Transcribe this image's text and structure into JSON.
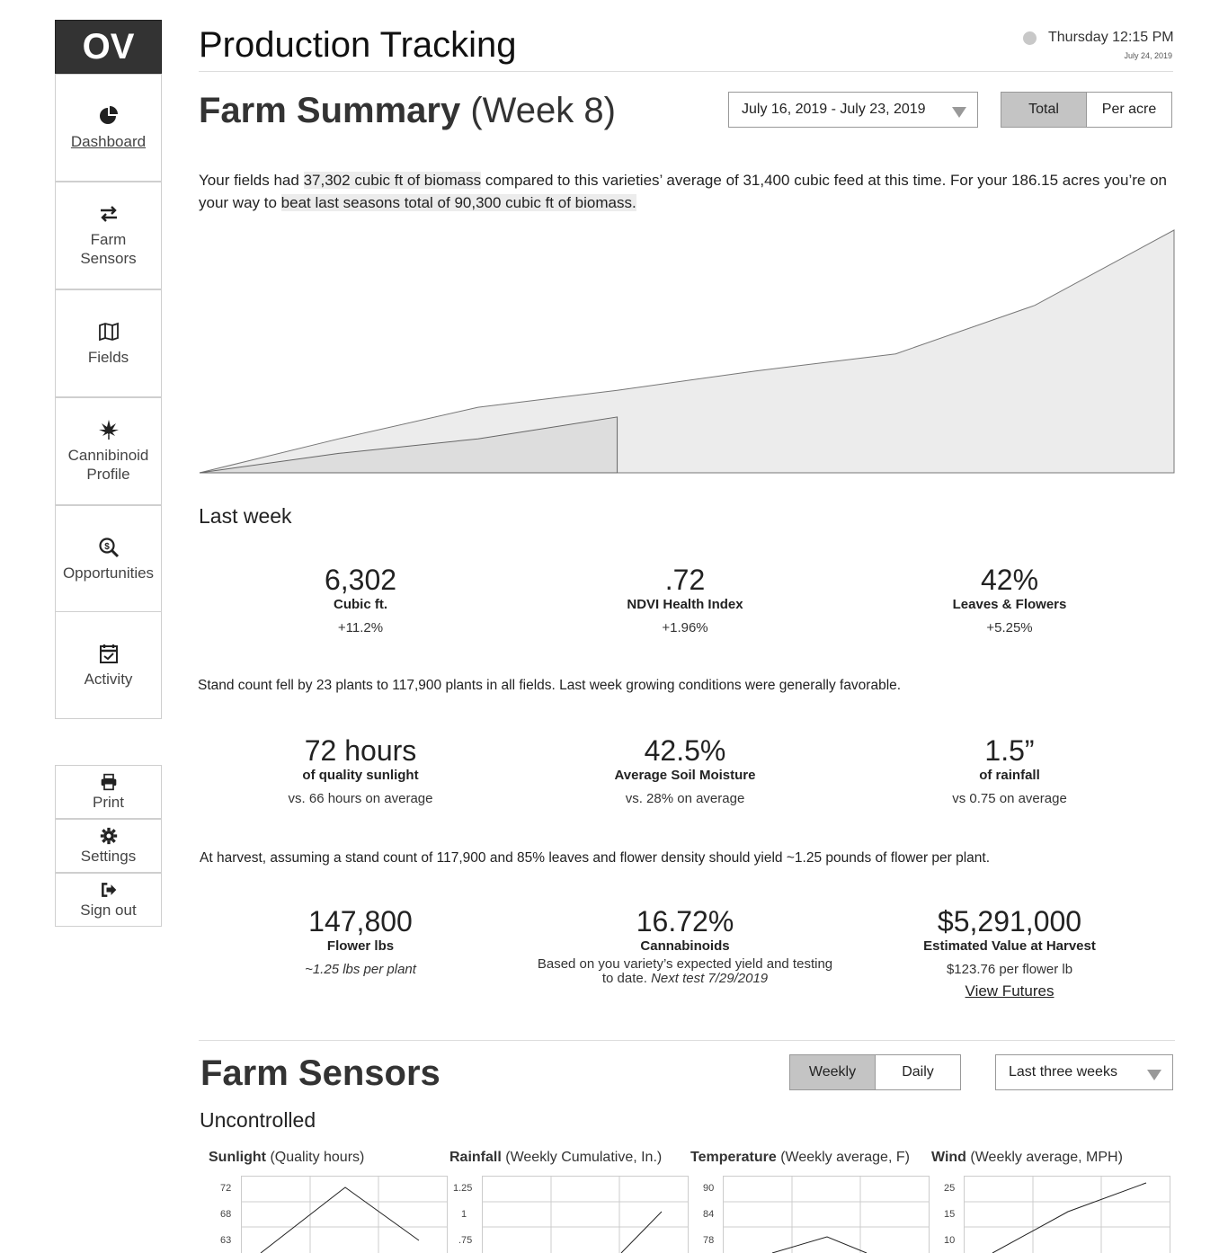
{
  "sidebar": {
    "logo": "OV",
    "items": [
      {
        "label": "Dashboard",
        "icon": "pie-chart-icon"
      },
      {
        "label": "Farm\nSensors",
        "icon": "exchange-arrows-icon"
      },
      {
        "label": "Fields",
        "icon": "map-icon"
      },
      {
        "label": "Cannibinoid\nProfile",
        "icon": "leaf-icon"
      },
      {
        "label": "Opportunities",
        "icon": "search-dollar-icon"
      },
      {
        "label": "Activity",
        "icon": "calendar-check-icon"
      }
    ],
    "utilities": [
      {
        "label": "Print",
        "icon": "print-icon"
      },
      {
        "label": "Settings",
        "icon": "gear-icon"
      },
      {
        "label": "Sign out",
        "icon": "sign-out-icon"
      }
    ]
  },
  "header": {
    "title": "Production Tracking",
    "clock": "Thursday 12:15 PM",
    "date": "July 24, 2019"
  },
  "summary": {
    "title_bold": "Farm Summary",
    "title_rest": "(Week 8)",
    "date_range": "July 16, 2019 - July 23, 2019",
    "toggle": [
      "Total",
      "Per acre"
    ],
    "para": {
      "p1": "Your fields had",
      "hl1": "37,302 cubic ft of biomass",
      "p2": "compared to this varieties’ average of 31,400 cubic feed at this time.  For your 186.15 acres you’re on  your way to",
      "hl2": "beat last seasons total of 90,300 cubic ft of biomass."
    }
  },
  "chart_data": {
    "type": "area",
    "series": [
      {
        "values": [
          0,
          8,
          14,
          23
        ]
      },
      {
        "values": [
          0,
          14,
          27,
          34,
          42,
          49,
          69,
          100
        ]
      }
    ]
  },
  "last_week": {
    "heading": "Last week",
    "stats": [
      {
        "value": "6,302",
        "label": "Cubic ft.",
        "change": "+11.2%"
      },
      {
        "value": ".72",
        "label": "NDVI Health Index",
        "change": "+1.96%"
      },
      {
        "value": "42%",
        "label": "Leaves & Flowers",
        "change": "+5.25%"
      }
    ],
    "sentence": "Stand count fell by 23 plants to 117,900 plants in all fields.  Last week growing conditions were generally favorable."
  },
  "conditions": {
    "stats": [
      {
        "value": "72 hours",
        "label": "of quality sunlight",
        "compare": "vs. 66 hours on average"
      },
      {
        "value": "42.5%",
        "label": "Average Soil Moisture",
        "compare": "vs. 28% on average"
      },
      {
        "value": "1.5”",
        "label": "of rainfall",
        "compare": "vs 0.75 on average"
      }
    ],
    "sentence": "At harvest, assuming a stand count of 117,900 and 85% leaves and flower density should yield ~1.25 pounds of flower per plant."
  },
  "harvest": {
    "stats": [
      {
        "value": "147,800",
        "label": "Flower lbs",
        "note": "~1.25 lbs per plant"
      },
      {
        "value": "16.72%",
        "label": "Cannabinoids",
        "note_a": "Based on you variety’s expected yield and testing",
        "note_b": "to date.",
        "note_c": "Next test 7/29/2019"
      },
      {
        "value": "$5,291,000",
        "label": "Estimated Value at Harvest",
        "note": "$123.76 per flower lb",
        "link": "View Futures"
      }
    ]
  },
  "sensors": {
    "title": "Farm Sensors",
    "toggle": [
      "Weekly",
      "Daily"
    ],
    "range": "Last three weeks",
    "subtitle": "Uncontrolled",
    "charts": [
      {
        "title_bold": "Sunlight",
        "title_rest": "(Quality hours)",
        "ticks": [
          "72",
          "68",
          "63"
        ]
      },
      {
        "title_bold": "Rainfall",
        "title_rest": "(Weekly Cumulative, In.)",
        "ticks": [
          "1.25",
          "1",
          ".75"
        ]
      },
      {
        "title_bold": "Temperature",
        "title_rest": "(Weekly average, F)",
        "ticks": [
          "90",
          "84",
          "78"
        ]
      },
      {
        "title_bold": "Wind",
        "title_rest": "(Weekly average, MPH)",
        "ticks": [
          "25",
          "15",
          "10"
        ]
      }
    ]
  }
}
